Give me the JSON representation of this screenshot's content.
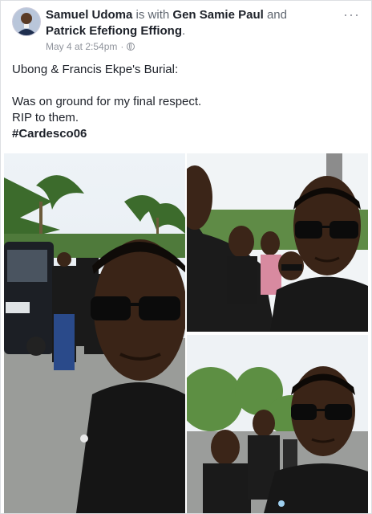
{
  "post": {
    "author": "Samuel Udoma",
    "with_text": "is with",
    "tagged_1": "Gen Samie Paul",
    "and_text": "and",
    "tagged_2": "Patrick Efefiong Effiong",
    "period": ".",
    "timestamp": "May 4 at 2:54pm",
    "separator": "·",
    "more_label": "···",
    "privacy_icon": "globe-icon",
    "text_line_1": "Ubong & Francis Ekpe's Burial:",
    "text_line_2": "Was on ground for my final respect.",
    "text_line_3": "RIP to them.",
    "hashtag": "#Cardesco06"
  },
  "photos": [
    {
      "name": "selfie-funeral-procession"
    },
    {
      "name": "selfie-with-crowd"
    },
    {
      "name": "selfie-with-mourners"
    }
  ],
  "colors": {
    "text": "#1d2129",
    "muted": "#90949c",
    "border": "#dddfe2"
  }
}
